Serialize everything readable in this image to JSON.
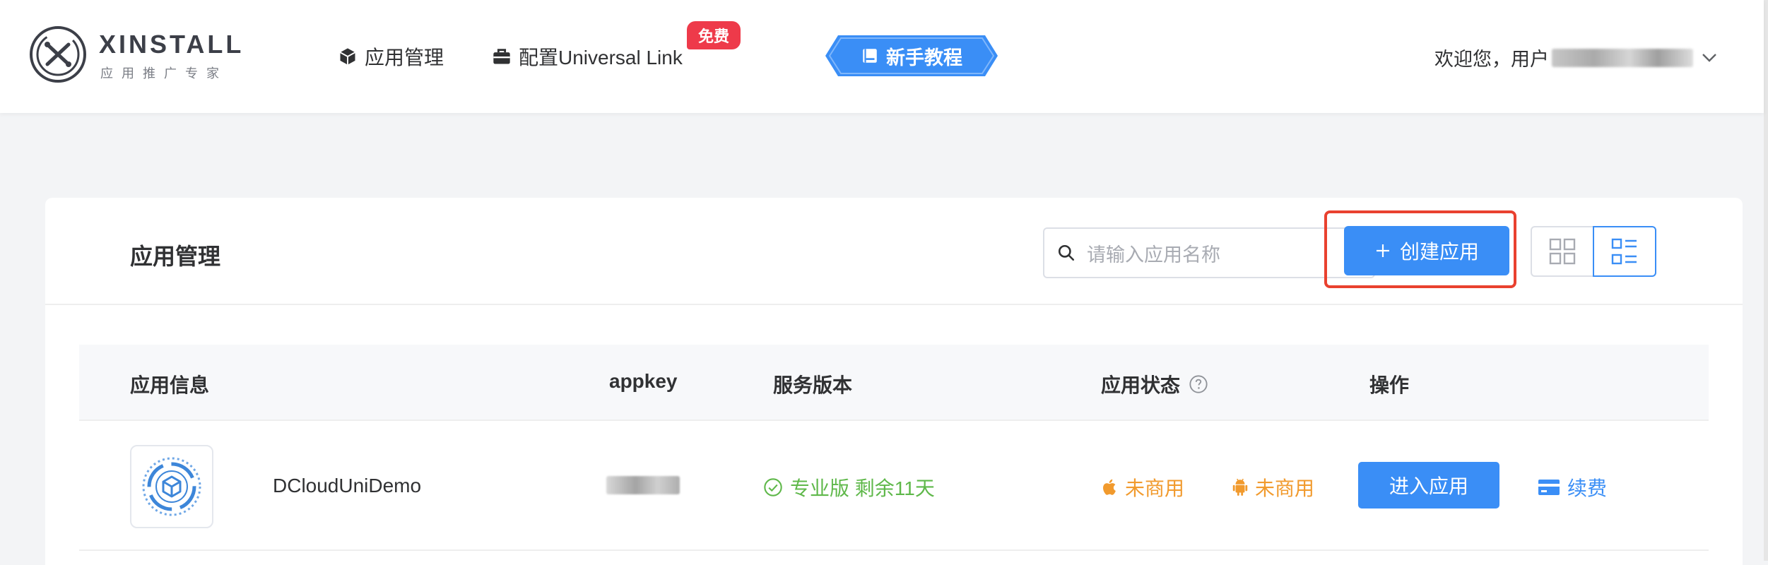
{
  "brand": {
    "name": "XINSTALL",
    "tagline": "应用推广专家",
    "logo_icon": "xinstall-logo-icon"
  },
  "nav": {
    "items": [
      {
        "label": "应用管理",
        "icon": "cube-icon"
      },
      {
        "label": "配置Universal Link",
        "icon": "briefcase-icon",
        "badge": "免费"
      }
    ],
    "tutorial": {
      "label": "新手教程",
      "icon": "book-icon"
    },
    "colors": {
      "accent": "#3a8ef6",
      "badge": "#ee3a4a"
    }
  },
  "user": {
    "welcome": "欢迎您，用户",
    "dropdown_icon": "chevron-down-icon"
  },
  "page": {
    "title": "应用管理",
    "search_placeholder": "请输入应用名称",
    "create_button": "创建应用",
    "view_modes": [
      "grid-view-icon",
      "list-view-icon"
    ],
    "active_view": "list"
  },
  "table": {
    "columns": [
      "应用信息",
      "appkey",
      "服务版本",
      "应用状态",
      "操作"
    ],
    "rows": [
      {
        "app_name": "DCloudUniDemo",
        "version": "专业版 剩余11天",
        "ios_status": "未商用",
        "android_status": "未商用",
        "enter_label": "进入应用",
        "renew_label": "续费"
      }
    ]
  },
  "colors": {
    "primary": "#3a8ef6",
    "success": "#5fb84a",
    "warning": "#f19a2d",
    "highlight_border": "#e9412f"
  }
}
